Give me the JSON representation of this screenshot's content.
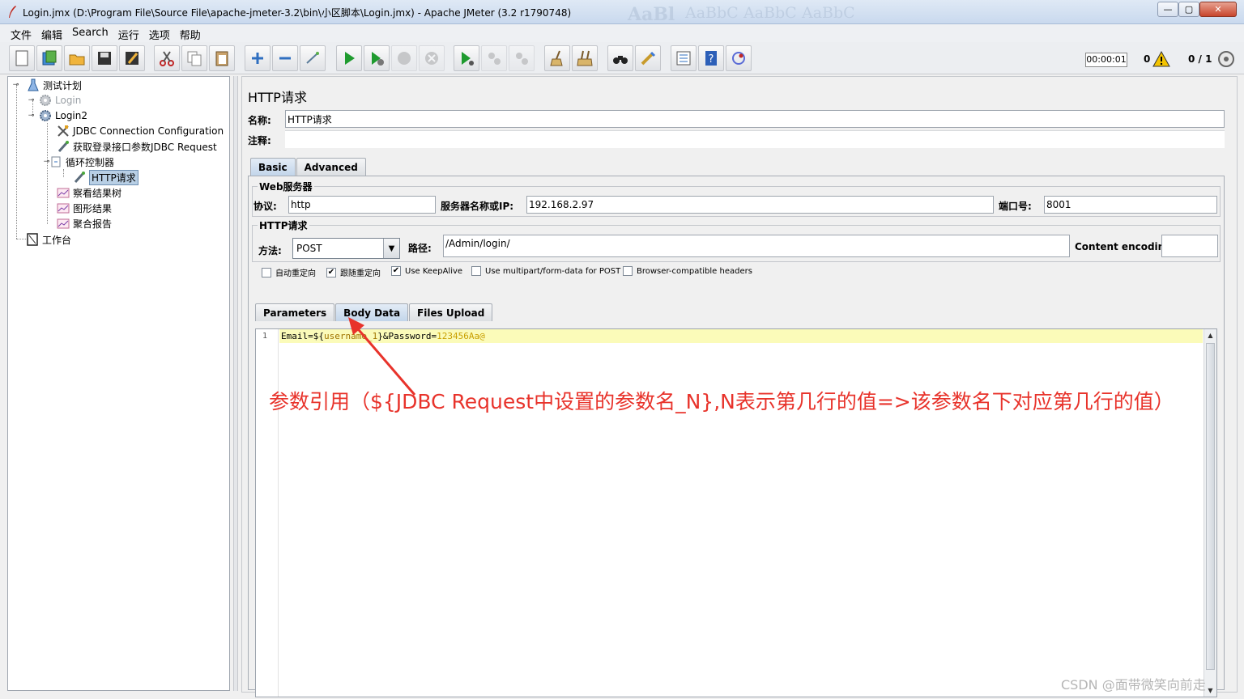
{
  "window": {
    "title": "Login.jmx (D:\\Program File\\Source File\\apache-jmeter-3.2\\bin\\小区脚本\\Login.jmx) - Apache JMeter (3.2 r1790748)",
    "close_glyph": "✕",
    "min_glyph": "—",
    "max_glyph": "▢"
  },
  "menu": [
    "文件",
    "编辑",
    "Search",
    "运行",
    "选项",
    "帮助"
  ],
  "status": {
    "timer": "00:00:01",
    "errors": "0",
    "threads": "0 / 1"
  },
  "tree": {
    "nodes": [
      {
        "label": "测试计划"
      },
      {
        "label": "Login"
      },
      {
        "label": "Login2"
      },
      {
        "label": "JDBC Connection Configuration"
      },
      {
        "label": "获取登录接口参数JDBC Request"
      },
      {
        "label": "循环控制器"
      },
      {
        "label": "HTTP请求"
      },
      {
        "label": "察看结果树"
      },
      {
        "label": "图形结果"
      },
      {
        "label": "聚合报告"
      },
      {
        "label": "工作台"
      }
    ]
  },
  "panel": {
    "title": "HTTP请求",
    "name_label": "名称:",
    "name_value": "HTTP请求",
    "comment_label": "注释:",
    "tabs": [
      "Basic",
      "Advanced"
    ],
    "web_server": {
      "group": "Web服务器",
      "protocol_label": "协议:",
      "protocol": "http",
      "server_label": "服务器名称或IP:",
      "server": "192.168.2.97",
      "port_label": "端口号:",
      "port": "8001"
    },
    "http_request": {
      "group": "HTTP请求",
      "method_label": "方法:",
      "method": "POST",
      "path_label": "路径:",
      "path": "/Admin/login/",
      "encoding_label": "Content encoding:",
      "encoding": ""
    },
    "checkboxes": [
      {
        "label": "自动重定向",
        "checked": false
      },
      {
        "label": "跟随重定向",
        "checked": true
      },
      {
        "label": "Use KeepAlive",
        "checked": true
      },
      {
        "label": "Use multipart/form-data for POST",
        "checked": false
      },
      {
        "label": "Browser-compatible headers",
        "checked": false
      }
    ],
    "sub_tabs": [
      "Parameters",
      "Body Data",
      "Files Upload"
    ],
    "body": {
      "line_number": "1",
      "k1": "Email",
      "eq1": "=",
      "v1": "${",
      "var": "username_1",
      "v1end": "}",
      "amp": "&",
      "k2": "Password",
      "eq2": "=",
      "v2": "123456Aa@"
    }
  },
  "annotation": "参数引用（${JDBC Request中设置的参数名_N},N表示第几行的值=>该参数名下对应第几行的值）",
  "watermark": "CSDN @面带微笑向前走",
  "colors": {
    "annotation": "#e8332b",
    "selection": "#b8cfe5",
    "highlight_line": "#fbfbb9"
  }
}
